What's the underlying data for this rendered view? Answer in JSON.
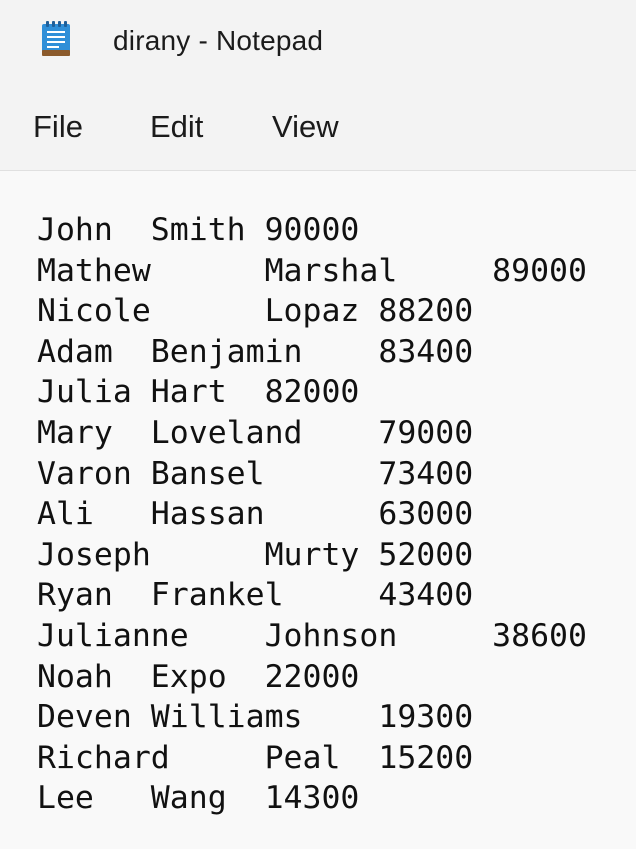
{
  "window": {
    "title": "dirany - Notepad",
    "icon": "notepad-icon"
  },
  "menu": {
    "file": "File",
    "edit": "Edit",
    "view": "View"
  },
  "editor": {
    "lines": [
      "John\tSmith\t90000",
      "Mathew\tMarshal\t89000",
      "Nicole\tLopaz\t88200",
      "Adam\tBenjamin\t83400",
      "Julia\tHart\t82000",
      "Mary\tLoveland\t79000",
      "Varon\tBansel\t73400",
      "Ali\tHassan\t63000",
      "Joseph\tMurty\t52000",
      "Ryan\tFrankel\t43400",
      "Julianne\tJohnson\t38600",
      "Noah\tExpo\t22000",
      "Deven\tWilliams\t19300",
      "Richard\tPeal\t15200",
      "Lee\tWang\t14300"
    ]
  },
  "colors": {
    "chrome_background": "#f3f3f3",
    "editor_background": "#f9f9f9",
    "text": "#111111",
    "icon_blue": "#2f8fd8",
    "icon_brown": "#8b5a2b"
  }
}
